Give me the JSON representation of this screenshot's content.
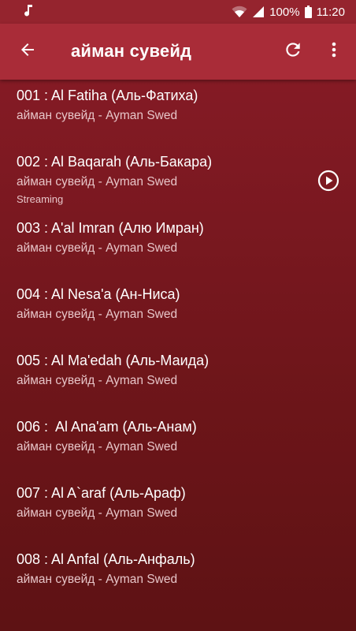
{
  "status_bar": {
    "battery": "100%",
    "time": "11:20",
    "icons": [
      "music-note-icon",
      "wifi-icon",
      "signal-icon",
      "battery-icon"
    ]
  },
  "toolbar": {
    "title": "айман сувейд",
    "back_icon": "arrow-back-icon",
    "refresh_icon": "refresh-icon",
    "more_icon": "more-vert-icon",
    "color": "#a92c38"
  },
  "tracks": [
    {
      "title": "001 : Al Fatiha (Аль-Фатиха)",
      "subtitle": "айман сувейд - Ayman Swed",
      "status": ""
    },
    {
      "title": "002 : Al Baqarah (Аль-Бакара)",
      "subtitle": "айман сувейд - Ayman Swed",
      "status": "Streaming",
      "active": true,
      "play_icon": "play-circle-icon"
    },
    {
      "title": "003 : A'al Imran (Алю Имран)",
      "subtitle": "айман сувейд - Ayman Swed",
      "status": ""
    },
    {
      "title": "004 : Al Nesa'a (Ан-Ниса)",
      "subtitle": "айман сувейд - Ayman Swed",
      "status": ""
    },
    {
      "title": "005 : Al Ma'edah (Аль-Маида)",
      "subtitle": "айман сувейд - Ayman Swed",
      "status": ""
    },
    {
      "title": "006 :  Al Ana'am (Аль-Анам)",
      "subtitle": "айман сувейд - Ayman Swed",
      "status": ""
    },
    {
      "title": "007 : Al A`araf (Аль-Араф)",
      "subtitle": "айман сувейд - Ayman Swed",
      "status": ""
    },
    {
      "title": "008 : Al Anfal (Аль-Анфаль)",
      "subtitle": "айман сувейд - Ayman Swed",
      "status": ""
    }
  ]
}
